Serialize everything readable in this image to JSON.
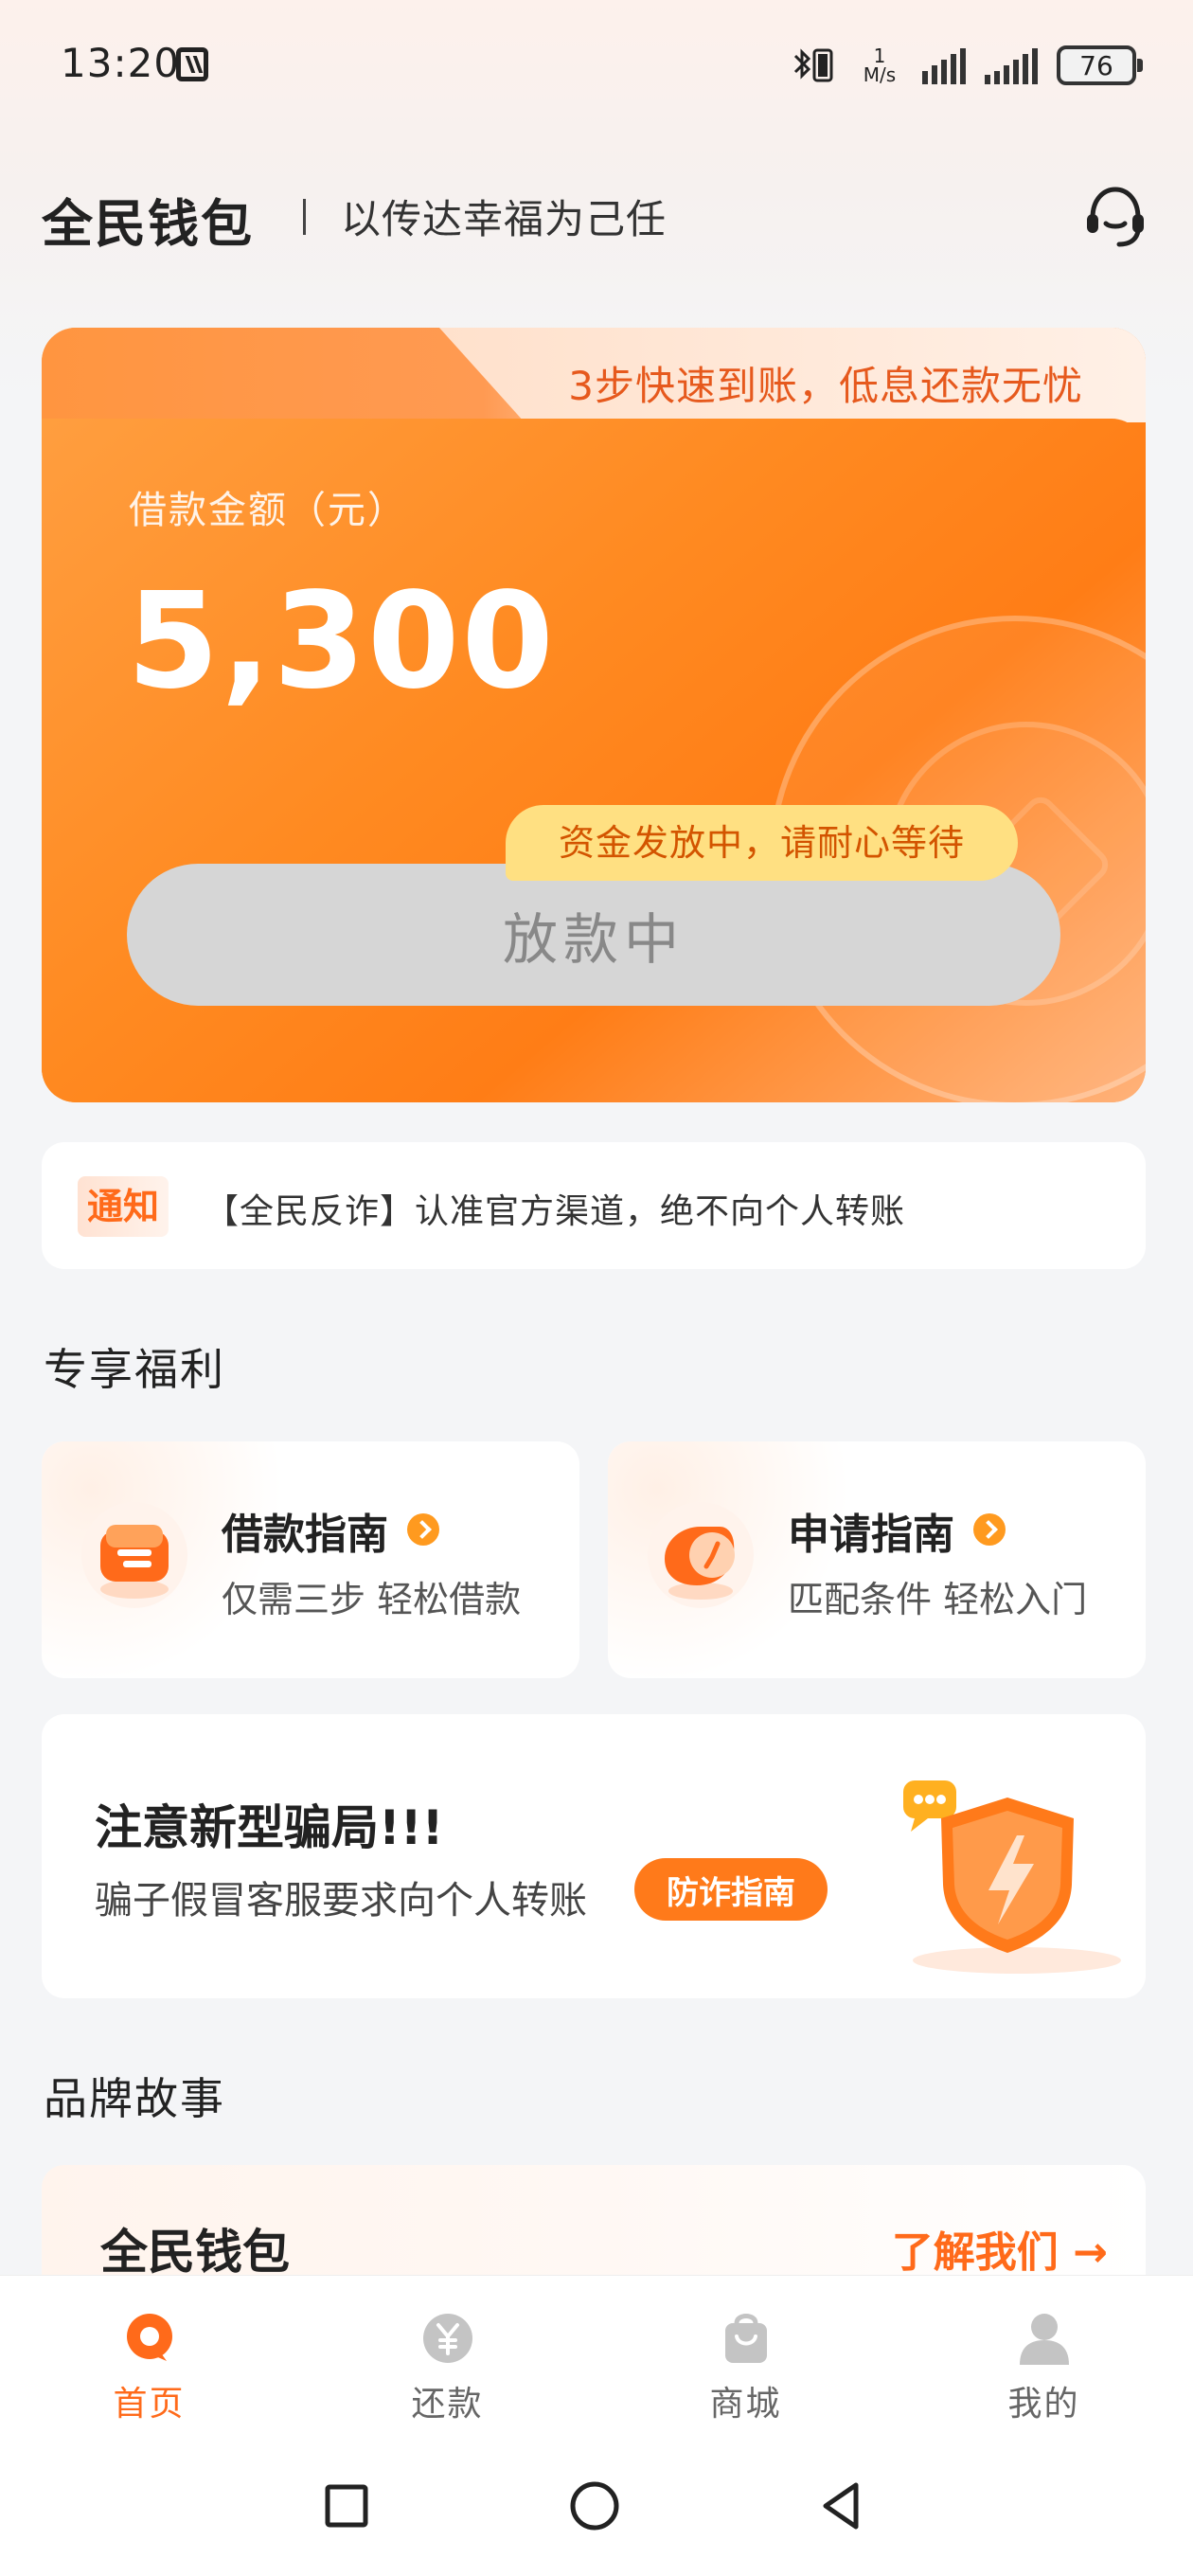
{
  "status_bar": {
    "time": "13:20",
    "net_speed_value": "1",
    "net_speed_unit": "M/s",
    "battery": "76"
  },
  "header": {
    "brand": "全民钱包",
    "slogan": "以传达幸福为己任"
  },
  "loan_card": {
    "tab_text": "3步快速到账，低息还款无忧",
    "amount_label": "借款金额（元）",
    "amount_value": "5,300",
    "status_bubble": "资金发放中，请耐心等待",
    "button_label": "放款中"
  },
  "notice": {
    "tag": "通知",
    "text": "【全民反诈】认准官方渠道，绝不向个人转账"
  },
  "benefits": {
    "section_title": "专享福利",
    "items": [
      {
        "title": "借款指南",
        "subtitle": "仅需三步 轻松借款"
      },
      {
        "title": "申请指南",
        "subtitle": "匹配条件 轻松入门"
      }
    ]
  },
  "scam": {
    "title": "注意新型骗局!!!",
    "desc": "骗子假冒客服要求向个人转账",
    "button": "防诈指南"
  },
  "brand_story": {
    "section_title": "品牌故事",
    "card_title": "全民钱包",
    "link": "了解我们 →"
  },
  "bottom_nav": {
    "items": [
      {
        "label": "首页",
        "icon": "home-icon"
      },
      {
        "label": "还款",
        "icon": "repay-icon"
      },
      {
        "label": "商城",
        "icon": "shop-icon"
      },
      {
        "label": "我的",
        "icon": "profile-icon"
      }
    ]
  },
  "colors": {
    "accent": "#ff6a1a",
    "card_orange": "#ff8a22",
    "bubble_yellow": "#ffe082"
  }
}
